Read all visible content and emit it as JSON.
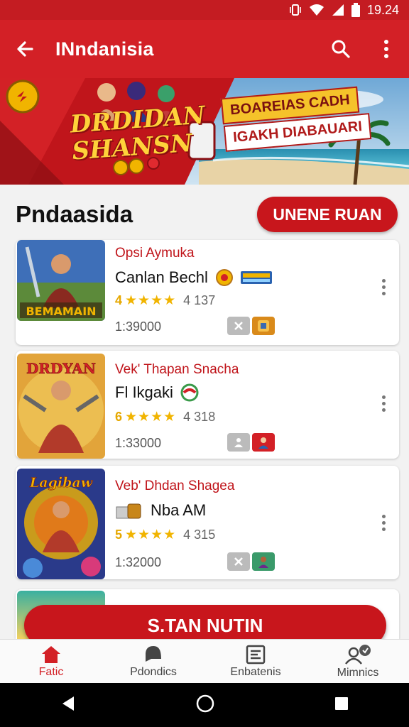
{
  "status_bar": {
    "time": "19.24"
  },
  "app_bar": {
    "title": "INndanisia"
  },
  "banner": {
    "title_line1": "DRDIDAN",
    "title_line2": "SHANSN",
    "tag1": "BOAREIAS CADH",
    "tag2": "IGAKH DIABAUARI"
  },
  "section": {
    "title": "Pndaasida",
    "button_label": "UNENE RUAN"
  },
  "games": [
    {
      "subtitle": "Opsi Aymuka",
      "name": "Canlan Bechl",
      "rating": "4",
      "reviews": "4 137",
      "installs": "1:39000",
      "thumb_text": "BEMAMAIN"
    },
    {
      "subtitle": "Vek' Thapan Snacha",
      "name": "Fl Ikgaki",
      "rating": "6",
      "reviews": "4 318",
      "installs": "1:33000",
      "thumb_text": "DRDYAN"
    },
    {
      "subtitle": "Veb' Dhdan Shagea",
      "name": "Nba AM",
      "rating": "5",
      "reviews": "4 315",
      "installs": "1:32000",
      "thumb_text": "Lagibaw"
    }
  ],
  "floating_button": {
    "label": "S.TAN NUTIN"
  },
  "bottom_nav": [
    {
      "label": "Fatic",
      "icon": "home-icon"
    },
    {
      "label": "Pdondics",
      "icon": "chat-icon"
    },
    {
      "label": "Enbatenis",
      "icon": "news-icon"
    },
    {
      "label": "Mimnics",
      "icon": "people-icon"
    }
  ],
  "colors": {
    "primary": "#d32026",
    "accent": "#f1b400"
  }
}
